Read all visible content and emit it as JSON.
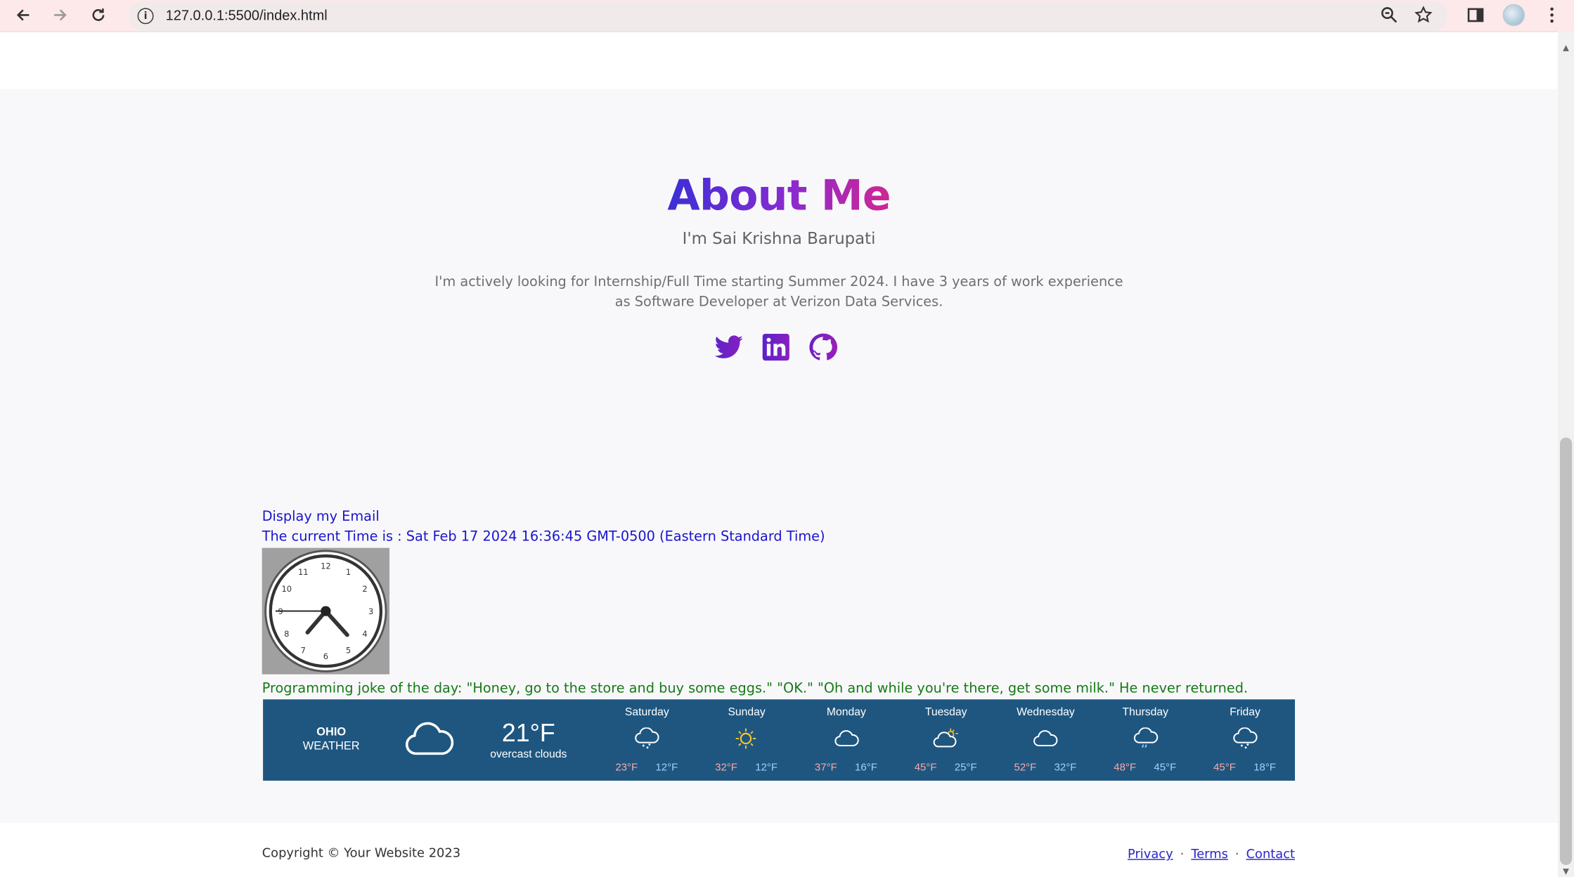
{
  "browser": {
    "url": "127.0.0.1:5500/index.html"
  },
  "about": {
    "title": "About Me",
    "subtitle": "I'm Sai Krishna Barupati",
    "description": "I'm actively looking for Internship/Full Time starting Summer 2024. I have 3 years of work experience as Software Developer at Verizon Data Services.",
    "socials": [
      {
        "name": "twitter-icon"
      },
      {
        "name": "linkedin-icon"
      },
      {
        "name": "github-icon"
      }
    ],
    "accent_gradient": [
      "#3b2fd6",
      "#8a2ad0",
      "#d12692"
    ],
    "icon_color": "#7b1fc4"
  },
  "email_link": "Display my Email",
  "current_time": "The current Time is : Sat Feb 17 2024 16:36:45 GMT-0500 (Eastern Standard Time)",
  "clock": {
    "numbers": [
      "12",
      "1",
      "2",
      "3",
      "4",
      "5",
      "6",
      "7",
      "8",
      "9",
      "10",
      "11"
    ],
    "time": "16:36:45"
  },
  "joke": "Programming joke of the day: \"Honey, go to the store and buy some eggs.\" \"OK.\" \"Oh and while you're there, get some milk.\" He never returned.",
  "weather": {
    "city": "OHIO",
    "label": "WEATHER",
    "temp": "21°F",
    "description": "overcast clouds",
    "current_icon": "cloud-icon",
    "bg_color": "#1e5680",
    "days": [
      {
        "name": "Saturday",
        "icon": "snow-cloud-icon",
        "hi": "23°F",
        "lo": "12°F"
      },
      {
        "name": "Sunday",
        "icon": "sun-icon",
        "hi": "32°F",
        "lo": "12°F"
      },
      {
        "name": "Monday",
        "icon": "cloud-icon",
        "hi": "37°F",
        "lo": "16°F"
      },
      {
        "name": "Tuesday",
        "icon": "partly-cloudy-icon",
        "hi": "45°F",
        "lo": "25°F"
      },
      {
        "name": "Wednesday",
        "icon": "cloud-icon",
        "hi": "52°F",
        "lo": "32°F"
      },
      {
        "name": "Thursday",
        "icon": "rain-cloud-icon",
        "hi": "48°F",
        "lo": "45°F"
      },
      {
        "name": "Friday",
        "icon": "snow-cloud-icon",
        "hi": "45°F",
        "lo": "18°F"
      }
    ]
  },
  "footer": {
    "copyright": "Copyright © Your Website 2023",
    "links": [
      "Privacy",
      "Terms",
      "Contact"
    ],
    "separator": "·"
  }
}
